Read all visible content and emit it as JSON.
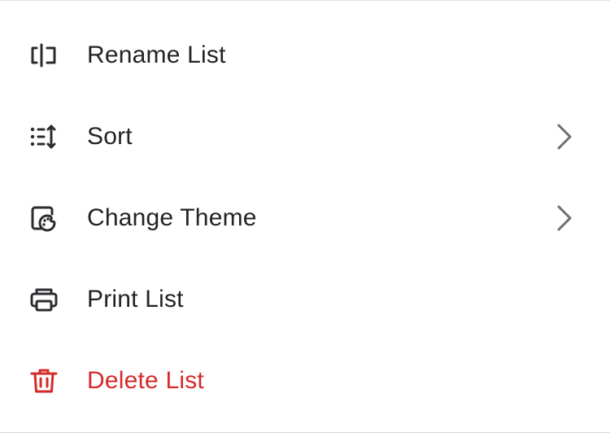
{
  "menu": {
    "items": [
      {
        "label": "Rename List",
        "icon": "rename-icon",
        "has_submenu": false
      },
      {
        "label": "Sort",
        "icon": "sort-icon",
        "has_submenu": true
      },
      {
        "label": "Change Theme",
        "icon": "theme-palette-icon",
        "has_submenu": true
      },
      {
        "label": "Print List",
        "icon": "printer-icon",
        "has_submenu": false
      },
      {
        "label": "Delete List",
        "icon": "trash-icon",
        "has_submenu": false,
        "color": "#d42a2a"
      }
    ]
  },
  "colors": {
    "text": "#222326",
    "icon": "#2b2c30",
    "danger": "#d42a2a",
    "chevron": "#6e6e73",
    "background": "#ffffff"
  }
}
